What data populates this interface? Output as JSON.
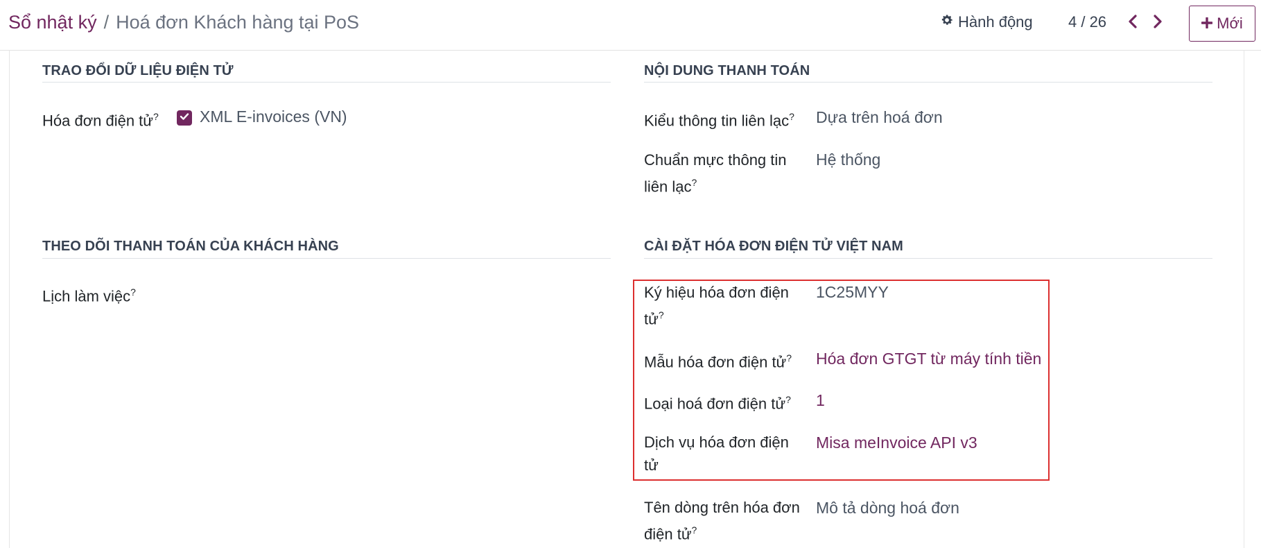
{
  "header": {
    "breadcrumb_parent": "Sổ nhật ký",
    "breadcrumb_separator": "/",
    "breadcrumb_current": "Hoá đơn Khách hàng tại PoS",
    "action_label": "Hành động",
    "pager_text": "4 / 26",
    "new_label": "Mới"
  },
  "sections": {
    "edi": {
      "title": "TRAO ĐỔI DỮ LIỆU ĐIỆN TỬ",
      "einvoice_label": "Hóa đơn điện tử",
      "einvoice_option": "XML E-invoices (VN)",
      "einvoice_checked": true
    },
    "payment_content": {
      "title": "NỘI DUNG THANH TOÁN",
      "contact_type_label": "Kiểu thông tin liên lạc",
      "contact_type_value": "Dựa trên hoá đơn",
      "contact_standard_label_line1": "Chuẩn mực thông tin",
      "contact_standard_label_line2": "liên lạc",
      "contact_standard_value": "Hệ thống"
    },
    "customer_payment": {
      "title": "THEO DÕI THANH TOÁN CỦA KHÁCH HÀNG",
      "schedule_label": "Lịch làm việc"
    },
    "vn_einvoice": {
      "title": "CÀI ĐẶT HÓA ĐƠN ĐIỆN TỬ VIỆT NAM",
      "symbol_label_line1": "Ký hiệu hóa đơn điện",
      "symbol_label_line2": "tử",
      "symbol_value": "1C25MYY",
      "template_label": "Mẫu hóa đơn điện tử",
      "template_value": "Hóa đơn GTGT từ máy tính tiền",
      "type_label": "Loại hoá đơn điện tử",
      "type_value": "1",
      "service_label_line1": "Dịch vụ hóa đơn điện",
      "service_label_line2": "tử",
      "service_value": "Misa meInvoice API v3",
      "line_name_label_line1": "Tên dòng trên hóa đơn",
      "line_name_label_line2": "điện tử",
      "line_name_value": "Mô tả dòng hoá đơn"
    }
  },
  "help_marker": "?",
  "colors": {
    "brand": "#71275f",
    "highlight": "#dc2f2f"
  },
  "icons": {
    "action": "gear-icon",
    "prev": "chevron-left-icon",
    "next": "chevron-right-icon",
    "new": "plus-icon",
    "checkbox": "check-icon"
  }
}
